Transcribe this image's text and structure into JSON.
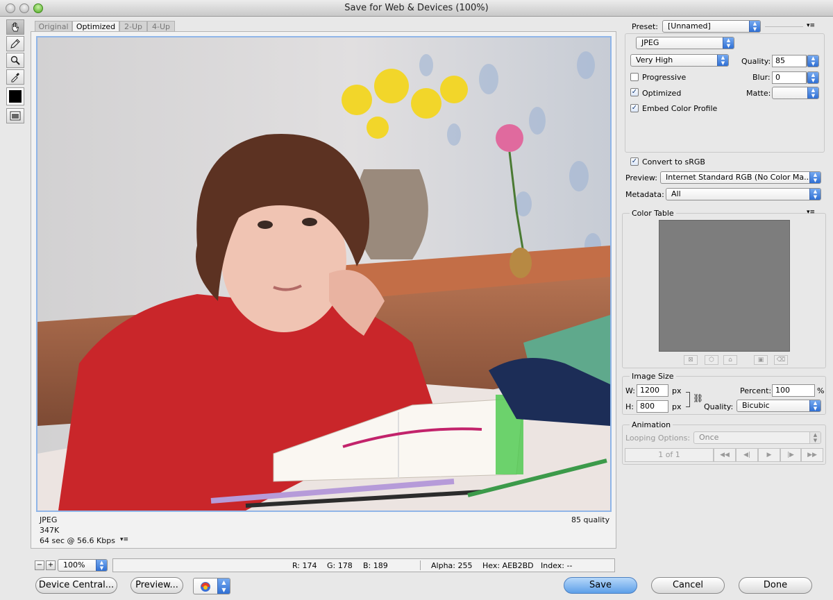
{
  "window": {
    "title": "Save for Web & Devices (100%)"
  },
  "tabs": [
    "Original",
    "Optimized",
    "2-Up",
    "4-Up"
  ],
  "image_info": {
    "format": "JPEG",
    "size": "347K",
    "download_time": "64 sec @ 56.6 Kbps",
    "quality_label": "85 quality"
  },
  "statusbar": {
    "zoom": "100%",
    "r": "R: 174",
    "g": "G: 178",
    "b": "B: 189",
    "alpha": "Alpha: 255",
    "hex": "Hex: AEB2BD",
    "index": "Index: --"
  },
  "settings": {
    "preset_label": "Preset:",
    "preset_value": "[Unnamed]",
    "format_value": "JPEG",
    "compression_value": "Very High",
    "quality_label": "Quality:",
    "quality_value": "85",
    "progressive_label": "Progressive",
    "progressive_checked": false,
    "blur_label": "Blur:",
    "blur_value": "0",
    "optimized_label": "Optimized",
    "optimized_checked": true,
    "matte_label": "Matte:",
    "matte_value": "",
    "embed_label": "Embed Color Profile",
    "embed_checked": true,
    "convert_label": "Convert to sRGB",
    "convert_checked": true,
    "preview_label": "Preview:",
    "preview_value": "Internet Standard RGB (No Color Ma...",
    "metadata_label": "Metadata:",
    "metadata_value": "All"
  },
  "color_table": {
    "title": "Color Table"
  },
  "image_size": {
    "title": "Image Size",
    "w_label": "W:",
    "w_value": "1200",
    "h_label": "H:",
    "h_value": "800",
    "unit": "px",
    "percent_label": "Percent:",
    "percent_value": "100",
    "percent_unit": "%",
    "quality_label": "Quality:",
    "quality_value": "Bicubic"
  },
  "animation": {
    "title": "Animation",
    "looping_label": "Looping Options:",
    "looping_value": "Once",
    "frame": "1 of 1"
  },
  "buttons": {
    "device_central": "Device Central...",
    "preview": "Preview...",
    "save": "Save",
    "cancel": "Cancel",
    "done": "Done"
  },
  "icons": [
    "hand-tool-icon",
    "slice-select-tool-icon",
    "zoom-tool-icon",
    "eyedropper-tool-icon",
    "eyedropper-color-swatch",
    "toggle-slices-visibility-icon",
    "chain-link-icon",
    "browser-icon",
    "panel-menu-icon"
  ]
}
